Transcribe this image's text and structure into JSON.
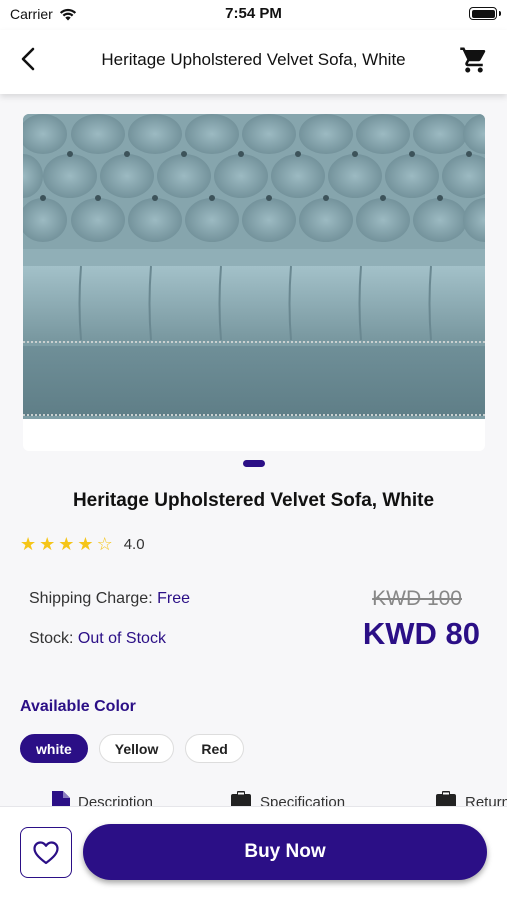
{
  "status_bar": {
    "carrier": "Carrier",
    "time": "7:54 PM"
  },
  "nav": {
    "title": "Heritage Upholstered Velvet Sofa, White",
    "back_icon": "chevron-left-icon",
    "cart_icon": "cart-icon"
  },
  "gallery": {
    "image_description": "tufted velvet sofa",
    "page_count": 1,
    "active_page": 1
  },
  "product": {
    "title": "Heritage Upholstered Velvet Sofa, White",
    "rating": 4.0,
    "rating_text": "4.0",
    "shipping_label": "Shipping Charge: ",
    "shipping_value": "Free",
    "stock_label": "Stock: ",
    "stock_value": "Out of Stock",
    "old_price": "KWD 100",
    "price": "KWD 80"
  },
  "colors": {
    "label": "Available Color",
    "options": [
      "white",
      "Yellow",
      "Red"
    ],
    "selected": "white"
  },
  "tabs": [
    {
      "label": "Description",
      "icon": "document-icon"
    },
    {
      "label": "Specification",
      "icon": "clipboard-icon"
    },
    {
      "label": "Return",
      "icon": "clipboard-icon"
    }
  ],
  "actions": {
    "buy_label": "Buy Now",
    "favorite_icon": "heart-icon"
  },
  "theme": {
    "accent": "#2b0f86",
    "star": "#f5c518",
    "sofa": "#7f9ea6"
  }
}
